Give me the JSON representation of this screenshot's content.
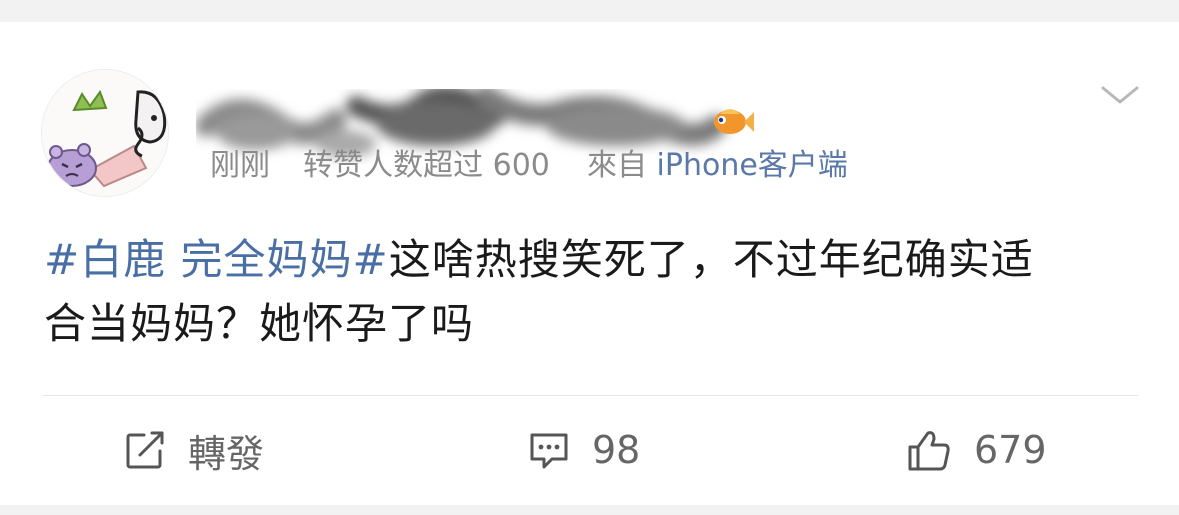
{
  "post": {
    "time": "刚刚",
    "reposts_note": "转赞人数超过 600",
    "source_prefix": "來自",
    "source": "iPhone客户端",
    "hashtag": "#白鹿 完全妈妈#",
    "text_line1": "这啥热搜笑死了，不过年纪确实适",
    "text_line2": "合当妈妈？她怀孕了吗"
  },
  "actions": {
    "repost_label": "轉發",
    "comment_count": "98",
    "like_count": "679"
  },
  "icons": {
    "menu": "chevron-down-icon",
    "repost": "repost-icon",
    "comment": "comment-icon",
    "like": "thumbs-up-icon"
  },
  "colors": {
    "hashtag": "#4a6fa5",
    "source": "#5a78a8",
    "meta": "#8b8b8b"
  }
}
